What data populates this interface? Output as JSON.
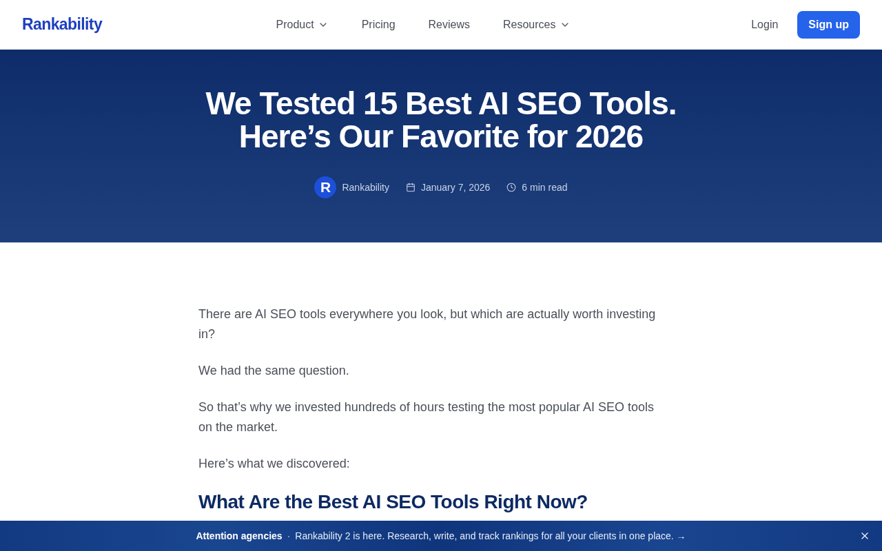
{
  "header": {
    "logo": "Rankability",
    "nav": [
      {
        "label": "Product",
        "dropdown": true
      },
      {
        "label": "Pricing",
        "dropdown": false
      },
      {
        "label": "Reviews",
        "dropdown": false
      },
      {
        "label": "Resources",
        "dropdown": true
      }
    ],
    "login": "Login",
    "signup": "Sign up"
  },
  "hero": {
    "title": "We Tested 15 Best AI SEO Tools. Here’s Our Favorite for 2026",
    "author": {
      "avatar_letter": "R",
      "name": "Rankability"
    },
    "date": "January 7, 2026",
    "read_time": "6 min read"
  },
  "article": {
    "paragraphs": [
      "There are AI SEO tools everywhere you look, but which are actually worth investing in?",
      "We had the same question.",
      "So that’s why we invested hundreds of hours testing the most popular AI SEO tools on the market.",
      "Here’s what we discovered:"
    ],
    "heading": "What Are the Best AI SEO Tools Right Now?"
  },
  "banner": {
    "label": "Attention agencies",
    "separator": "·",
    "message": "Rankability 2 is here. Research, write, and track rankings for all your clients in one place. →"
  }
}
